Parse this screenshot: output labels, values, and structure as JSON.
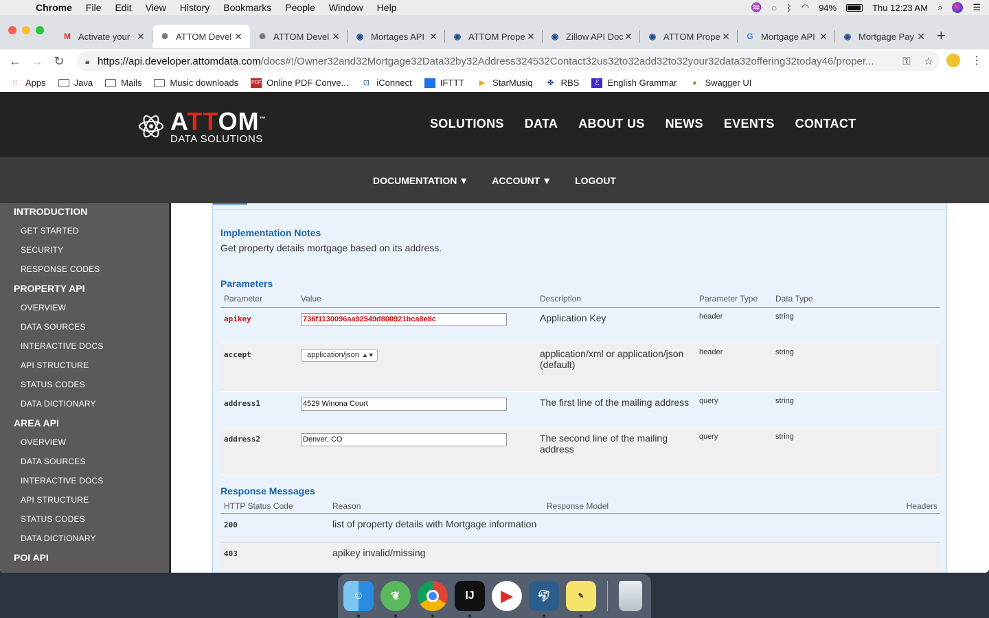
{
  "menubar": {
    "app": "Chrome",
    "items": [
      "File",
      "Edit",
      "View",
      "History",
      "Bookmarks",
      "People",
      "Window",
      "Help"
    ],
    "battery": "94%",
    "clock": "Thu 12:23 AM"
  },
  "tabs": [
    {
      "title": "Activate your",
      "icon": "gmail-icon"
    },
    {
      "title": "ATTOM Devel",
      "icon": "attom-icon",
      "active": true
    },
    {
      "title": "ATTOM Devel",
      "icon": "attom-icon"
    },
    {
      "title": "Mortages API",
      "icon": "blue-circle-icon"
    },
    {
      "title": "ATTOM Prope",
      "icon": "blue-circle-icon"
    },
    {
      "title": "Zillow API Doc",
      "icon": "blue-circle-icon"
    },
    {
      "title": "ATTOM Prope",
      "icon": "blue-circle-icon"
    },
    {
      "title": "Mortgage API",
      "icon": "google-icon"
    },
    {
      "title": "Mortgage Pay",
      "icon": "blue-circle-icon"
    }
  ],
  "omnibox": {
    "host": "https://api.developer.attomdata.com",
    "path": "/docs#!/Owner32and32Mortgage32Data32by32Address324532Contact32us32to32add32to32your32data32offering32today46/proper..."
  },
  "bookmarks": [
    "Apps",
    "Java",
    "Mails",
    "Music downloads",
    "Online PDF Conve...",
    "iConnect",
    "IFTTT",
    "StarMusiq",
    "RBS",
    "English Grammar",
    "Swagger UI"
  ],
  "site": {
    "logo_main_a": "A",
    "logo_main_tt": "TT",
    "logo_main_om": "OM",
    "logo_tm": "™",
    "logo_sub": "DATA SOLUTIONS",
    "nav": [
      "SOLUTIONS",
      "DATA",
      "ABOUT US",
      "NEWS",
      "EVENTS",
      "CONTACT"
    ],
    "subnav": [
      "DOCUMENTATION",
      "ACCOUNT",
      "LOGOUT"
    ]
  },
  "sidebar": [
    {
      "type": "sec",
      "label": "INTRODUCTION"
    },
    {
      "type": "item",
      "label": "GET STARTED"
    },
    {
      "type": "item",
      "label": "SECURITY"
    },
    {
      "type": "item",
      "label": "RESPONSE CODES"
    },
    {
      "type": "sec",
      "label": "PROPERTY API"
    },
    {
      "type": "item",
      "label": "OVERVIEW"
    },
    {
      "type": "item",
      "label": "DATA SOURCES"
    },
    {
      "type": "item",
      "label": "INTERACTIVE DOCS"
    },
    {
      "type": "item",
      "label": "API STRUCTURE"
    },
    {
      "type": "item",
      "label": "STATUS CODES"
    },
    {
      "type": "item",
      "label": "DATA DICTIONARY"
    },
    {
      "type": "sec",
      "label": "AREA API"
    },
    {
      "type": "item",
      "label": "OVERVIEW"
    },
    {
      "type": "item",
      "label": "DATA SOURCES"
    },
    {
      "type": "item",
      "label": "INTERACTIVE DOCS"
    },
    {
      "type": "item",
      "label": "API STRUCTURE"
    },
    {
      "type": "item",
      "label": "STATUS CODES"
    },
    {
      "type": "item",
      "label": "DATA DICTIONARY"
    },
    {
      "type": "sec",
      "label": "POI API"
    }
  ],
  "content": {
    "impl_heading": "Implementation Notes",
    "impl_text": "Get property details mortgage based on its address.",
    "params_heading": "Parameters",
    "param_headers": [
      "Parameter",
      "Value",
      "Description",
      "Parameter Type",
      "Data Type"
    ],
    "params": [
      {
        "name": "apikey",
        "value": "736f1130096aa92549d800921bca8e8c",
        "desc": "Application Key",
        "ptype": "header",
        "dtype": "string"
      },
      {
        "name": "accept",
        "value": "application/json",
        "desc": "application/xml or application/json (default)",
        "ptype": "header",
        "dtype": "string"
      },
      {
        "name": "address1",
        "value": "4529 Winona Court",
        "desc": "The first line of the mailing address",
        "ptype": "query",
        "dtype": "string"
      },
      {
        "name": "address2",
        "value": "Denver, CO",
        "desc": "The second line of the mailing address",
        "ptype": "query",
        "dtype": "string"
      }
    ],
    "resp_heading": "Response Messages",
    "resp_headers": [
      "HTTP Status Code",
      "Reason",
      "Response Model",
      "Headers"
    ],
    "responses": [
      {
        "code": "200",
        "reason": "list of property details with Mortgage information"
      },
      {
        "code": "403",
        "reason": "apikey invalid/missing"
      }
    ]
  },
  "dock": [
    "finder",
    "spring-tool-suite",
    "chrome",
    "intellij",
    "player",
    "mysql-workbench",
    "stickies",
    "trash"
  ]
}
